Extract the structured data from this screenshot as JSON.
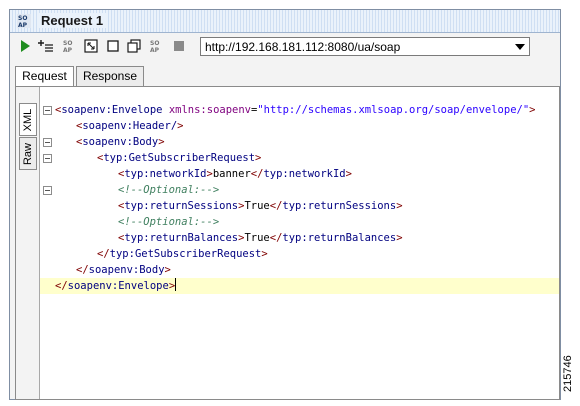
{
  "window": {
    "title": "Request 1",
    "title_icon": "soap-icon"
  },
  "toolbar": {
    "buttons": [
      {
        "name": "submit-request-button",
        "icon": "play-icon"
      },
      {
        "name": "add-to-testcase-button",
        "icon": "add-step-icon"
      },
      {
        "name": "soap-format-button",
        "icon": "soap-icon"
      },
      {
        "name": "maximize-editor-button",
        "icon": "maximize-icon"
      },
      {
        "name": "single-view-button",
        "icon": "square-icon"
      },
      {
        "name": "split-view-button",
        "icon": "window-split-icon"
      },
      {
        "name": "wsdl-button",
        "icon": "soap-icon"
      },
      {
        "name": "stop-button",
        "icon": "stop-icon"
      }
    ],
    "endpoint": "http://192.168.181.112:8080/ua/soap"
  },
  "tabs": [
    {
      "label": "Request",
      "active": true
    },
    {
      "label": "Response",
      "active": false
    }
  ],
  "side_tabs": [
    {
      "label": "XML",
      "active": true
    },
    {
      "label": "Raw",
      "active": false
    }
  ],
  "editor": {
    "lines": [
      {
        "indent": 0,
        "tag": "soapenv:Envelope",
        "attr_name": "xmlns:soapenv",
        "attr_value": "\"http://schemas.xmlsoap.org/soap/envelope/\""
      },
      {
        "indent": 1,
        "tag": "soapenv:Header/"
      },
      {
        "indent": 1,
        "tag": "soapenv:Body"
      },
      {
        "indent": 2,
        "tag": "typ:GetSubscriberRequest"
      },
      {
        "indent": 3,
        "tag": "typ:networkId",
        "value": "banner",
        "close": "typ:networkId"
      },
      {
        "indent": 3,
        "comment": "<!--Optional:-->"
      },
      {
        "indent": 3,
        "tag": "typ:returnSessions",
        "value": "True",
        "close": "typ:returnSessions"
      },
      {
        "indent": 3,
        "comment": "<!--Optional:-->"
      },
      {
        "indent": 3,
        "tag": "typ:returnBalances",
        "value": "True",
        "close": "typ:returnBalances"
      },
      {
        "indent": 2,
        "end": "typ:GetSubscriberRequest"
      },
      {
        "indent": 1,
        "end": "soapenv:Body"
      },
      {
        "indent": 0,
        "end": "soapenv:Envelope",
        "highlighted": true
      }
    ]
  },
  "figure_id": "215746",
  "colors": {
    "bracket": "#7f0000",
    "tag": "#000080",
    "attr_name": "#7f007f",
    "attr_value": "#2a00ff",
    "comment": "#3f7f5f",
    "current_line": "#ffffcc"
  }
}
